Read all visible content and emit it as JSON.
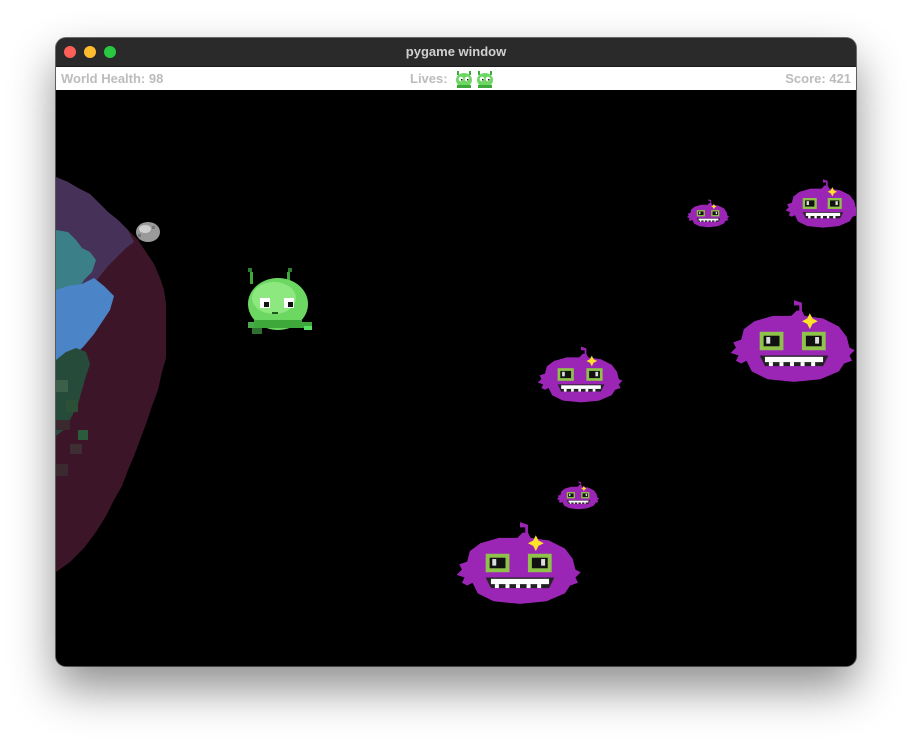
{
  "window": {
    "title": "pygame window"
  },
  "hud": {
    "health_label": "World Health: 98",
    "lives_label": "Lives:",
    "lives_count": 2,
    "score_label": "Score: 421"
  },
  "colors": {
    "background": "#000000",
    "hud_text": "#bcbcbc",
    "enemy": "#9b26b6",
    "player": "#5fd35a"
  },
  "entities": {
    "player": "green-alien",
    "enemies": [
      "purple-blob-enemy",
      "purple-blob-enemy",
      "purple-blob-enemy",
      "purple-blob-enemy",
      "purple-blob-enemy",
      "purple-blob-enemy"
    ],
    "planet": "pixel-planet",
    "projectile": "gray-asteroid"
  }
}
